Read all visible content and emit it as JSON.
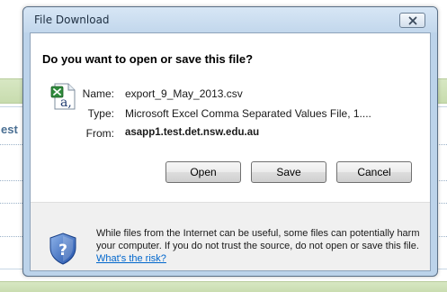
{
  "dialog": {
    "title": "File Download",
    "question": "Do you want to open or save this file?",
    "file": {
      "name_label": "Name:",
      "name_value": "export_9_May_2013.csv",
      "type_label": "Type:",
      "type_value": "Microsoft Excel Comma Separated Values File, 1....",
      "from_label": "From:",
      "from_value": "asapp1.test.det.nsw.edu.au",
      "icon": "excel-csv-file-icon"
    },
    "buttons": {
      "open": "Open",
      "save": "Save",
      "cancel": "Cancel"
    },
    "warning": {
      "text": "While files from the Internet can be useful, some files can potentially harm your computer. If you do not trust the source, do not open or save this file.",
      "link": "What's the risk?",
      "icon": "security-shield-icon"
    },
    "close_icon": "close-icon"
  },
  "background": {
    "partial_label": "est"
  },
  "colors": {
    "accent_link": "#0066cc",
    "titlebar": "#c2d7ec",
    "background_band": "#d0e2b8",
    "background_text": "#4a6f93"
  }
}
